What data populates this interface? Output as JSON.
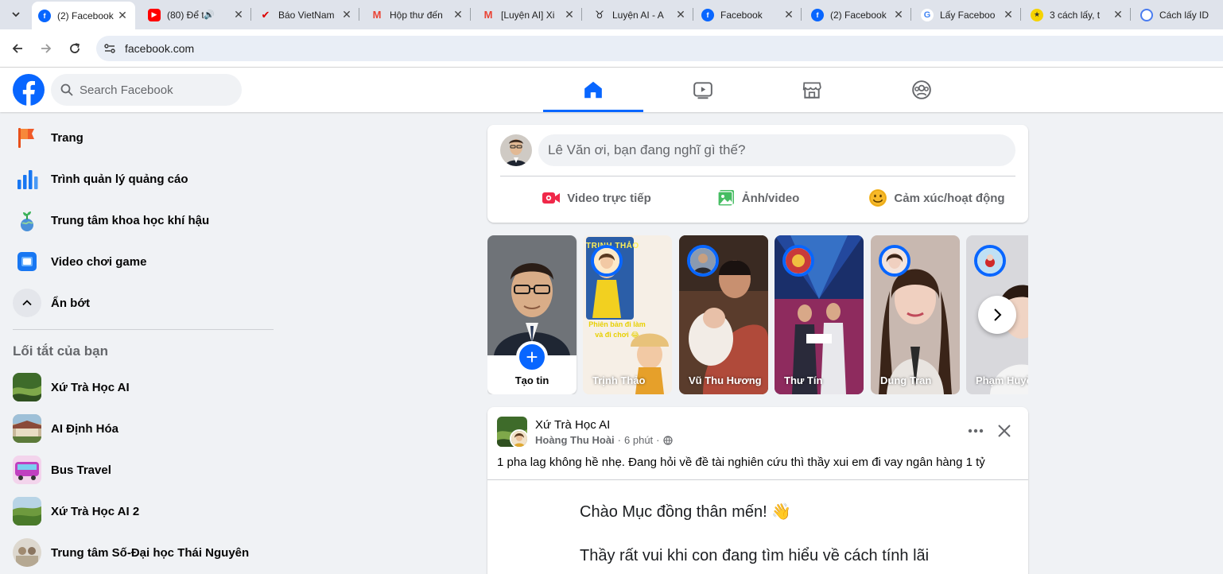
{
  "browser": {
    "tabs": [
      {
        "title": "(2) Facebook",
        "favicon": "facebook-icon",
        "active": true
      },
      {
        "title": "(80) Để t",
        "favicon": "youtube-icon",
        "active": false
      },
      {
        "title": "Báo VietNam",
        "favicon": "vietnamnet-icon",
        "active": false
      },
      {
        "title": "Hộp thư đến",
        "favicon": "gmail-icon",
        "active": false
      },
      {
        "title": "[Luyện AI] Xi",
        "favicon": "gmail-icon",
        "active": false
      },
      {
        "title": "Luyện AI - A",
        "favicon": "bull-icon",
        "active": false
      },
      {
        "title": "Facebook",
        "favicon": "facebook-icon",
        "active": false
      },
      {
        "title": "(2) Facebook",
        "favicon": "facebook-icon",
        "active": false
      },
      {
        "title": "Lấy Faceboo",
        "favicon": "google-icon",
        "active": false
      },
      {
        "title": "3 cách lấy, t",
        "favicon": "site-icon",
        "active": false
      },
      {
        "title": "Cách lấy ID",
        "favicon": "site-icon",
        "active": false
      }
    ],
    "url": "facebook.com"
  },
  "header": {
    "search_placeholder": "Search Facebook",
    "nav_tabs": [
      "home",
      "video",
      "marketplace",
      "groups"
    ]
  },
  "sidebar": {
    "items": [
      {
        "label": "Trang",
        "icon": "flag-icon"
      },
      {
        "label": "Trình quản lý quảng cáo",
        "icon": "ads-manager-icon"
      },
      {
        "label": "Trung tâm khoa học khí hậu",
        "icon": "climate-icon"
      },
      {
        "label": "Video chơi game",
        "icon": "gaming-video-icon"
      },
      {
        "label": "Ẩn bớt",
        "icon": "chevron-up-icon"
      }
    ],
    "shortcuts_heading": "Lối tắt của bạn",
    "shortcuts": [
      {
        "label": "Xứ Trà Học AI"
      },
      {
        "label": "AI Định Hóa"
      },
      {
        "label": "Bus Travel"
      },
      {
        "label": "Xứ Trà Học AI 2"
      },
      {
        "label": "Trung tâm Số-Đại học Thái Nguyên"
      }
    ]
  },
  "composer": {
    "placeholder": "Lê Văn ơi, bạn đang nghĩ gì thế?",
    "actions": [
      {
        "label": "Video trực tiếp",
        "color": "#f02849"
      },
      {
        "label": "Ảnh/video",
        "color": "#45bd62"
      },
      {
        "label": "Cảm xúc/hoạt động",
        "color": "#f7b928"
      }
    ]
  },
  "stories": {
    "create_label": "Tạo tin",
    "items": [
      {
        "name": "Trịnh Thảo",
        "overlay_title": "TRỊNH THẢO",
        "overlay_caption": "Phiên bản đi làm và đi chơi 😂"
      },
      {
        "name": "Vũ Thu Hương"
      },
      {
        "name": "Thư Tín"
      },
      {
        "name": "Dung Tran"
      },
      {
        "name": "Phạm Huyề"
      }
    ]
  },
  "post": {
    "group": "Xứ Trà Học AI",
    "author": "Hoàng Thu Hoài",
    "time": "6 phút",
    "separator": "·",
    "text": "1 pha lag không hề nhẹ. Đang hỏi về đề tài nghiên cứu thì thầy xui em đi vay ngân hàng 1 tỷ",
    "image_line1": "Chào Mục đồng thân mến! 👋",
    "image_line2": "Thầy rất vui khi con đang tìm hiểu về cách tính lãi"
  },
  "colors": {
    "brand": "#0866ff",
    "page_bg": "#f0f2f5",
    "secondary_text": "#65676b"
  }
}
